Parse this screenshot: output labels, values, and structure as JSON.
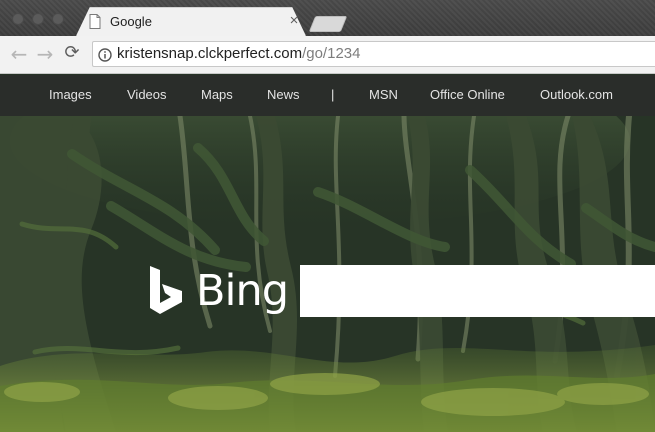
{
  "browser": {
    "tab": {
      "title": "Google",
      "close_glyph": "×"
    },
    "toolbar": {
      "back_glyph": "←",
      "forward_glyph": "→",
      "reload_glyph": "⟳"
    },
    "address": {
      "domain": "kristensnap.clckperfect.com",
      "path": "/go/1234"
    },
    "icons": {
      "page": "page-icon",
      "info": "info-icon",
      "close": "close-icon",
      "back": "back-arrow-icon",
      "forward": "forward-arrow-icon",
      "reload": "reload-icon"
    }
  },
  "bing_nav": {
    "items": [
      {
        "label": "Images"
      },
      {
        "label": "Videos"
      },
      {
        "label": "Maps"
      },
      {
        "label": "News"
      },
      {
        "label": "|"
      },
      {
        "label": "MSN"
      },
      {
        "label": "Office Online"
      },
      {
        "label": "Outlook.com"
      }
    ]
  },
  "bing": {
    "logo_text": "Bing",
    "search": {
      "value": "",
      "placeholder": ""
    }
  },
  "colors": {
    "nav_background": "#2a2d2b",
    "nav_text": "#e4e4e4",
    "search_box": "#ffffff",
    "tab_background": "#f1f1f1",
    "forest_green": "#3d5b34"
  }
}
